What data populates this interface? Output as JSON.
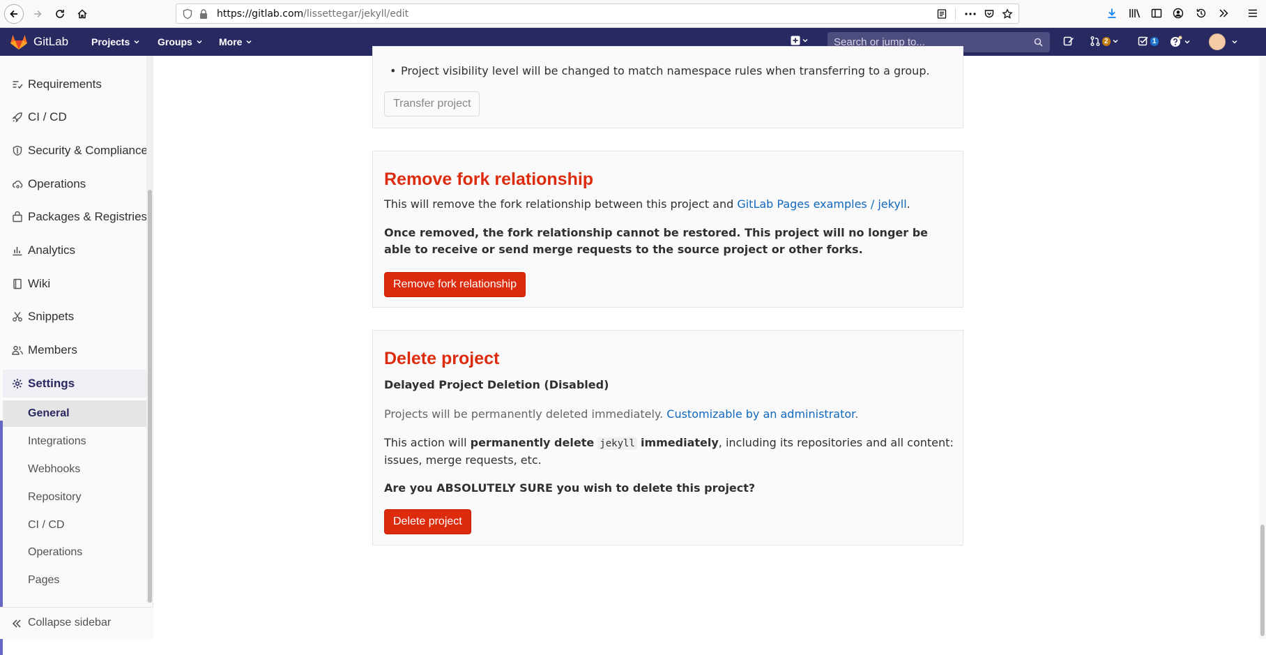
{
  "browser": {
    "url_host": "https://gitlab.com",
    "url_path": "/lissettegar/jekyll/edit"
  },
  "navbar": {
    "brand": "GitLab",
    "menus": [
      "Projects",
      "Groups",
      "More"
    ],
    "search_placeholder": "Search or jump to...",
    "mr_count": "2",
    "todo_count": "1"
  },
  "sidebar": {
    "items": [
      {
        "label": "Requirements",
        "icon": "requirements-icon"
      },
      {
        "label": "CI / CD",
        "icon": "rocket-icon"
      },
      {
        "label": "Security & Compliance",
        "icon": "shield-icon"
      },
      {
        "label": "Operations",
        "icon": "cloud-gear-icon"
      },
      {
        "label": "Packages & Registries",
        "icon": "package-icon"
      },
      {
        "label": "Analytics",
        "icon": "chart-icon"
      },
      {
        "label": "Wiki",
        "icon": "book-icon"
      },
      {
        "label": "Snippets",
        "icon": "scissors-icon"
      },
      {
        "label": "Members",
        "icon": "users-icon"
      }
    ],
    "settings_label": "Settings",
    "sub_items": [
      "General",
      "Integrations",
      "Webhooks",
      "Repository",
      "CI / CD",
      "Operations",
      "Pages"
    ],
    "collapse_label": "Collapse sidebar"
  },
  "transfer": {
    "bullet": "Project visibility level will be changed to match namespace rules when transferring to a group.",
    "button": "Transfer project"
  },
  "remove_fork": {
    "title": "Remove fork relationship",
    "text_prefix": "This will remove the fork relationship between this project and ",
    "link": "GitLab Pages examples / jekyll",
    "text_suffix": ".",
    "warning": "Once removed, the fork relationship cannot be restored. This project will no longer be able to receive or send merge requests to the source project or other forks.",
    "button": "Remove fork relationship"
  },
  "delete_project": {
    "title": "Delete project",
    "subtitle": "Delayed Project Deletion (Disabled)",
    "info_prefix": "Projects will be permanently deleted immediately. ",
    "info_link": "Customizable by an administrator",
    "info_suffix": ".",
    "action_1": "This action will ",
    "action_bold_1": "permanently delete",
    "project_name": "jekyll",
    "action_bold_2": "immediately",
    "action_2": ", including its repositories and all content: issues, merge requests, etc.",
    "confirm": "Are you ABSOLUTELY SURE you wish to delete this project?",
    "button": "Delete project"
  },
  "colors": {
    "navbar": "#292961",
    "danger": "#dd2b0e",
    "link": "#1068bf"
  }
}
